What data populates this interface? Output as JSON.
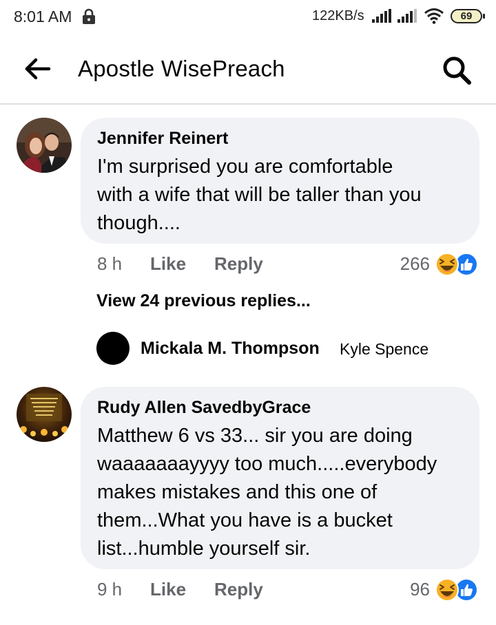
{
  "status_bar": {
    "time": "8:01 AM",
    "net_speed": "122KB/s",
    "battery": "69",
    "icons": [
      "lock-icon",
      "signal-icon",
      "signal-icon",
      "wifi-icon",
      "battery-icon"
    ]
  },
  "header": {
    "title": "Apostle WisePreach",
    "icons": [
      "back-arrow-icon",
      "search-icon"
    ]
  },
  "comments": [
    {
      "author": "Jennifer Reinert",
      "text_lines": [
        "I'm surprised you are comfortable",
        "with a wife that will be taller than you",
        "though...."
      ],
      "time": "8 h",
      "like_label": "Like",
      "reply_label": "Reply",
      "reactions_count": "266",
      "reaction_icons": [
        "haha-icon",
        "like-icon"
      ]
    },
    {
      "author": "Rudy Allen SavedbyGrace",
      "text_lines": [
        "Matthew 6 vs 33... sir you are doing",
        "waaaaaaayyyy too much.....everybody",
        "makes mistakes and this one of",
        "them...What you have is a bucket",
        "list...humble yourself sir."
      ],
      "time": "9 h",
      "like_label": "Like",
      "reply_label": "Reply",
      "reactions_count": "96",
      "reaction_icons": [
        "haha-icon",
        "like-icon"
      ]
    }
  ],
  "replies_thread": {
    "view_previous": "View 24 previous replies...",
    "reply_author": "Mickala M. Thompson",
    "reply_snippet": "Kyle Spence"
  },
  "colors": {
    "bubble_bg": "#f0f2f5",
    "secondary_text": "#65676b",
    "like_blue": "#1877f2",
    "haha_yellow": "#f7b125"
  }
}
